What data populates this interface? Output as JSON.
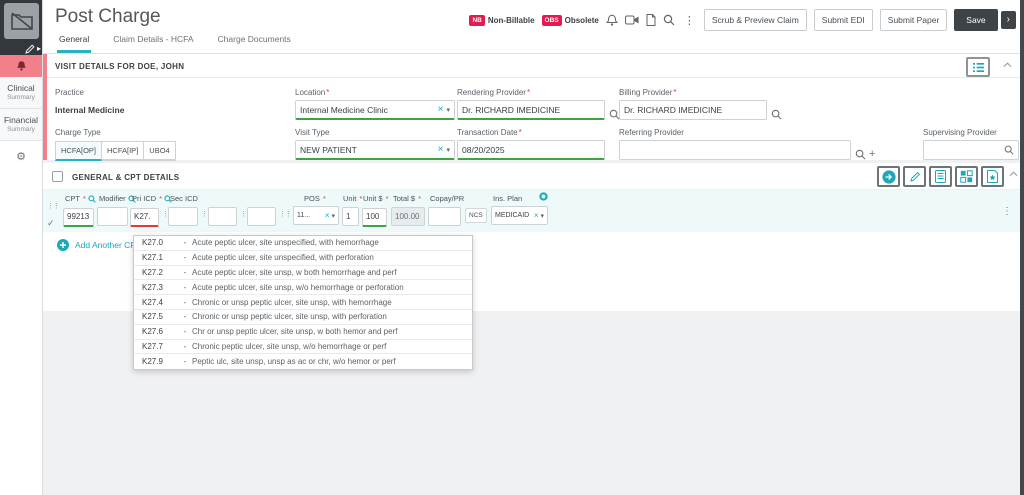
{
  "colors": {
    "accent_teal": "#1ba8b8",
    "badge_red": "#e31b4e",
    "salmon": "#f2808b",
    "dark": "#3e4347",
    "valid_green": "#43a047",
    "invalid_red": "#e53935"
  },
  "icons": {
    "kebab": "⋮",
    "clear": "×",
    "caret": "▾",
    "check": "✓",
    "gear": "⚙",
    "drag": "⋮⋮",
    "plus": "+",
    "next": "›",
    "flyout": "▸"
  },
  "sidebar": {
    "clinical_title": "Clinical",
    "clinical_sub": "Summary",
    "financial_title": "Financial",
    "financial_sub": "Summary"
  },
  "header": {
    "title": "Post Charge",
    "tabs": [
      {
        "label": "General"
      },
      {
        "label": "Claim Details - HCFA"
      },
      {
        "label": "Charge Documents"
      }
    ],
    "flags": [
      {
        "code": "NB",
        "label": "Non-Billable"
      },
      {
        "code": "OBS",
        "label": "Obsolete"
      }
    ],
    "actions": [
      {
        "label": "Scrub & Preview Claim"
      },
      {
        "label": "Submit EDI"
      },
      {
        "label": "Submit Paper"
      }
    ],
    "save_label": "Save"
  },
  "ui": {
    "required_mark": "*"
  },
  "visit": {
    "section_title": "VISIT DETAILS FOR DOE, JOHN",
    "practice_label": "Practice",
    "practice_value": "Internal Medicine",
    "location_label": "Location",
    "location_value": "Internal Medicine Clinic",
    "rendering_label": "Rendering Provider",
    "rendering_value": "Dr. RICHARD IMEDICINE",
    "billing_label": "Billing Provider",
    "billing_value": "Dr. RICHARD IMEDICINE",
    "charge_type_label": "Charge Type",
    "charge_types": [
      {
        "label": "HCFA[OP]"
      },
      {
        "label": "HCFA[IP]"
      },
      {
        "label": "UBO4"
      }
    ],
    "visit_type_label": "Visit Type",
    "visit_type_value": "NEW PATIENT",
    "transaction_label": "Transaction Date",
    "transaction_value": "08/20/2025",
    "referring_label": "Referring Provider",
    "referring_value": "",
    "supervising_label": "Supervising Provider",
    "supervising_value": ""
  },
  "cpt": {
    "section_title": "GENERAL & CPT DETAILS",
    "labels": {
      "cpt": "CPT",
      "modifier": "Modifier",
      "pri_icd": "Pri ICD",
      "sec_icd": "Sec ICD",
      "pos": "POS",
      "unit": "Unit",
      "unit_price": "Unit $",
      "total": "Total $",
      "copay": "Copay/PR",
      "ins_plan": "Ins. Plan"
    },
    "row": {
      "cpt": "99213",
      "modifier": "",
      "pri_icd": "K27.",
      "sec_icd_1": "",
      "sec_icd_2": "",
      "sec_icd_3": "",
      "pos": "11...",
      "unit": "1",
      "unit_price": "100",
      "total": "100.00",
      "copay": "",
      "ncs_label": "NCS",
      "ins_plan": "MEDICAID"
    },
    "add_label": "Add Another CPT",
    "dropdown_dash": "-",
    "dropdown": [
      {
        "code": "K27.0",
        "desc": "Acute peptic ulcer, site unspecified, with hemorrhage"
      },
      {
        "code": "K27.1",
        "desc": "Acute peptic ulcer, site unspecified, with perforation"
      },
      {
        "code": "K27.2",
        "desc": "Acute peptic ulcer, site unsp, w both hemorrhage and perf"
      },
      {
        "code": "K27.3",
        "desc": "Acute peptic ulcer, site unsp, w/o hemorrhage or perforation"
      },
      {
        "code": "K27.4",
        "desc": "Chronic or unsp peptic ulcer, site unsp, with hemorrhage"
      },
      {
        "code": "K27.5",
        "desc": "Chronic or unsp peptic ulcer, site unsp, with perforation"
      },
      {
        "code": "K27.6",
        "desc": "Chr or unsp peptic ulcer, site unsp, w both hemor and perf"
      },
      {
        "code": "K27.7",
        "desc": "Chronic peptic ulcer, site unsp, w/o hemorrhage or perf"
      },
      {
        "code": "K27.9",
        "desc": "Peptic ulc, site unsp, unsp as ac or chr, w/o hemor or perf"
      }
    ]
  }
}
